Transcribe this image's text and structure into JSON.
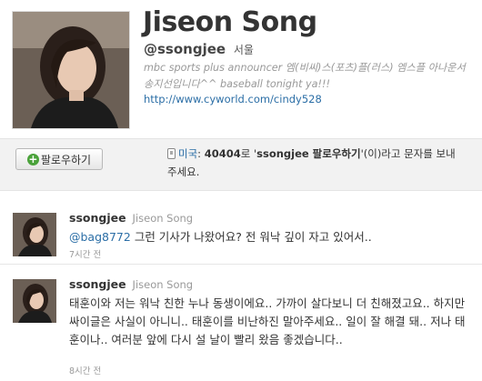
{
  "profile": {
    "name": "Jiseon Song",
    "handle": "@ssongjee",
    "location": "서울",
    "bio": "mbc sports plus announcer 엠(비씨)스(포츠)플(러스) 엠스플 아나운서 송지선입니다^^ baseball tonight ya!!!",
    "url": "http://www.cyworld.com/cindy528",
    "avatar_icon": "profile-photo"
  },
  "follow": {
    "button_label": "팔로우하기",
    "button_icon": "plus-icon",
    "sms": {
      "country": "미국",
      "separator": ":",
      "code": "40404",
      "text1": "로 '",
      "quoted": "ssongjee 팔로우하기",
      "text2": "'(이)라고 문자를 보내 주세요."
    }
  },
  "tweets": [
    {
      "username": "ssongjee",
      "display_name": "Jiseon Song",
      "mention": "@bag8772",
      "text": " 그런 기사가 나왔어요? 전 워낙 깊이 자고 있어서..",
      "time": "7시간 전"
    },
    {
      "username": "ssongjee",
      "display_name": "Jiseon Song",
      "text": "태훈이와 저는 워낙 친한 누나 동생이에요.. 가까이 살다보니 더 친해졌고요.. 하지만 싸이글은 사실이 아니니.. 태훈이를 비난하진 말아주세요.. 일이 잘 해결 돼.. 저나 태훈이나.. 여러분 앞에 다시 설 날이 빨리 왔음 좋겠습니다..",
      "time": "8시간 전"
    }
  ],
  "colors": {
    "link": "#2b6ea6",
    "muted": "#999999",
    "follow_icon": "#4aa23a"
  }
}
